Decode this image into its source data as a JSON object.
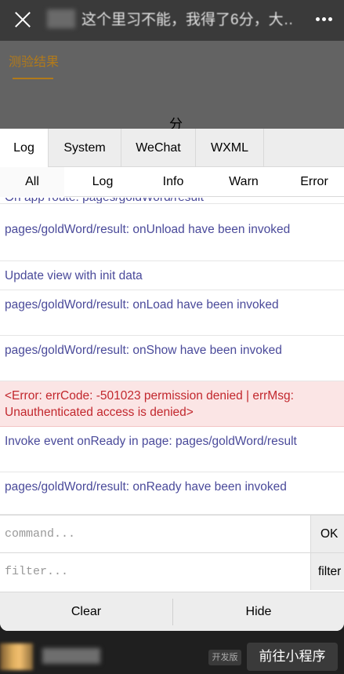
{
  "topbar": {
    "title": "这个里习不能，我得了6分，大…",
    "close_icon": "close-icon",
    "more_icon": "more-dots-icon"
  },
  "page": {
    "tab_label": "测验结果",
    "score_char": "分"
  },
  "console": {
    "tabs": [
      {
        "label": "Log",
        "active": true
      },
      {
        "label": "System",
        "active": false
      },
      {
        "label": "WeChat",
        "active": false
      },
      {
        "label": "WXML",
        "active": false
      }
    ],
    "filters": [
      {
        "label": "All",
        "active": true
      },
      {
        "label": "Log",
        "active": false
      },
      {
        "label": "Info",
        "active": false
      },
      {
        "label": "Warn",
        "active": false
      },
      {
        "label": "Error",
        "active": false
      }
    ],
    "logs": [
      {
        "text": "On app route: pages/goldWord/result",
        "type": "log"
      },
      {
        "text": "pages/goldWord/result: onUnload have been invoked",
        "type": "log"
      },
      {
        "text": "Update view with init data",
        "type": "log"
      },
      {
        "text": "pages/goldWord/result: onLoad have been invoked",
        "type": "log"
      },
      {
        "text": "pages/goldWord/result: onShow have been invoked",
        "type": "log"
      },
      {
        "text": "<Error: errCode: -501023 permission denied | errMsg: Unauthenticated access is denied>",
        "type": "error"
      },
      {
        "text": "Invoke event onReady in page: pages/goldWord/result",
        "type": "log"
      },
      {
        "text": "pages/goldWord/result: onReady have been invoked",
        "type": "log"
      }
    ],
    "command_placeholder": "command...",
    "command_button": "OK",
    "filter_placeholder": "filter...",
    "filter_button": "filter",
    "clear_label": "Clear",
    "hide_label": "Hide",
    "log_color": "#4a4a9a",
    "error_color": "#c2272d"
  },
  "footer": {
    "dev_badge": "开发版",
    "goto_label": "前往小程序"
  }
}
